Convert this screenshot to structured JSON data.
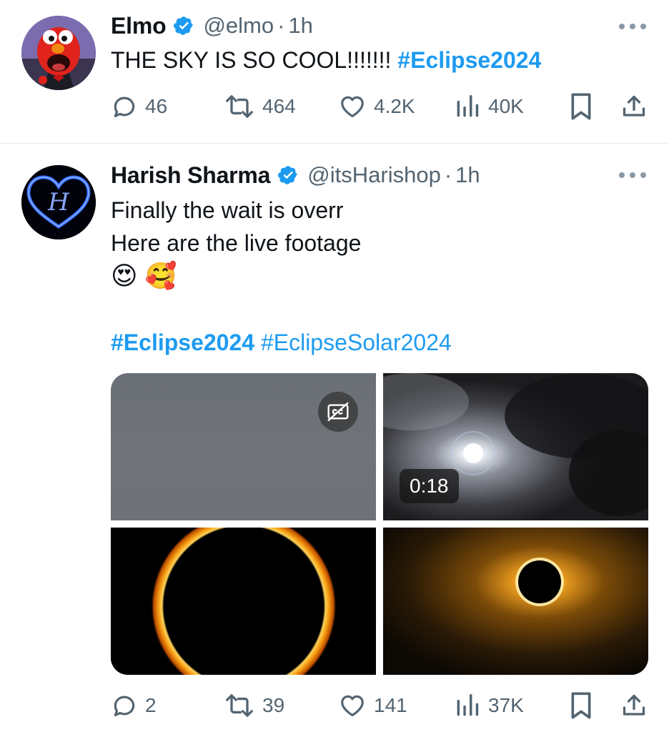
{
  "tweets": [
    {
      "name": "Elmo",
      "handle": "@elmo",
      "separator": "·",
      "time": "1h",
      "text": "THE SKY IS SO COOL!!!!!!! ",
      "hashtag": "#Eclipse2024",
      "stats": {
        "replies": "46",
        "retweets": "464",
        "likes": "4.2K",
        "views": "40K"
      }
    },
    {
      "name": "Harish Sharma",
      "handle": "@itsHarishop",
      "separator": "·",
      "time": "1h",
      "lines": [
        "Finally the wait is overr",
        "Here are the live footage"
      ],
      "emojis": "😍 🥰",
      "hashtag1": "#Eclipse2024",
      "hashtag2": "#EclipseSolar2024",
      "video_duration": "0:18",
      "stats": {
        "replies": "2",
        "retweets": "39",
        "likes": "141",
        "views": "37K"
      }
    }
  ],
  "colors": {
    "accent": "#1d9bf0",
    "muted": "#536471",
    "text": "#0f1419"
  },
  "icons": [
    "verified-badge-icon",
    "more-icon",
    "reply-icon",
    "retweet-icon",
    "like-icon",
    "views-icon",
    "bookmark-icon",
    "share-icon",
    "captions-off-icon"
  ]
}
